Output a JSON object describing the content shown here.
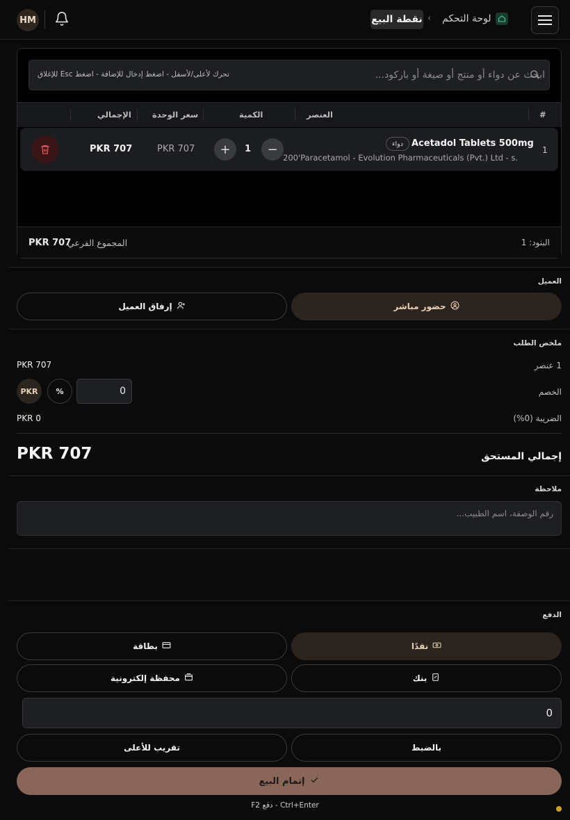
{
  "header": {
    "avatar_initials": "HM",
    "breadcrumb_home": "لوحة التحكم",
    "breadcrumb_current": "نقطة البيع"
  },
  "search": {
    "placeholder": "ابحث عن دواء أو منتج أو صيغة أو باركود...",
    "hint": "تحرك لأعلى/لأسفل - اضغط إدخال للإضافة - اضغط Esc للإغلاق"
  },
  "cart": {
    "columns": {
      "num": "#",
      "item": "العنصر",
      "qty": "الكمية",
      "unit_price": "سعر الوحدة",
      "total": "الإجمالي"
    },
    "rows": [
      {
        "num": "1",
        "name": "Acetadol Tablets 500mg",
        "badge": "دواء",
        "subtitle": "200'Paracetamol - Evolution Pharmaceuticals (Pvt.) Ltd - s.",
        "qty": "1",
        "unit_price": "PKR 707",
        "total": "PKR 707"
      }
    ],
    "items_count": "البنود: 1",
    "subtotal_label": "المجموع الفرعي",
    "subtotal_value": "PKR 707"
  },
  "customer": {
    "label": "العميل",
    "walk_in": "حضور مباشر",
    "attach": "إرفاق العميل"
  },
  "summary": {
    "label": "ملخص الطلب",
    "items_label": "1 عنصر",
    "items_value": "PKR 707",
    "discount_label": "الخصم",
    "discount_value": "0",
    "discount_pct": "%",
    "discount_currency": "PKR",
    "tax_label": "الضريبة (0%)",
    "tax_value": "PKR 0",
    "due_label": "إجمالي المستحق",
    "due_value": "PKR 707"
  },
  "note": {
    "label": "ملاحظة",
    "placeholder": "رقم الوصفة، اسم الطبيب..."
  },
  "payment": {
    "label": "الدفع",
    "cash": "نقدًا",
    "card": "بطاقة",
    "bank": "بنك",
    "wallet": "محفظة إلكترونية",
    "amount": "0",
    "exact": "بالضبط",
    "round_up": "تقريب للأعلى",
    "complete": "إتمام البيع",
    "shortcut": "F2 دفع - Ctrl+Enter"
  },
  "colors": {
    "accent": "#8a665a",
    "selected_pill": "#2c241e",
    "danger": "#3a1517"
  }
}
